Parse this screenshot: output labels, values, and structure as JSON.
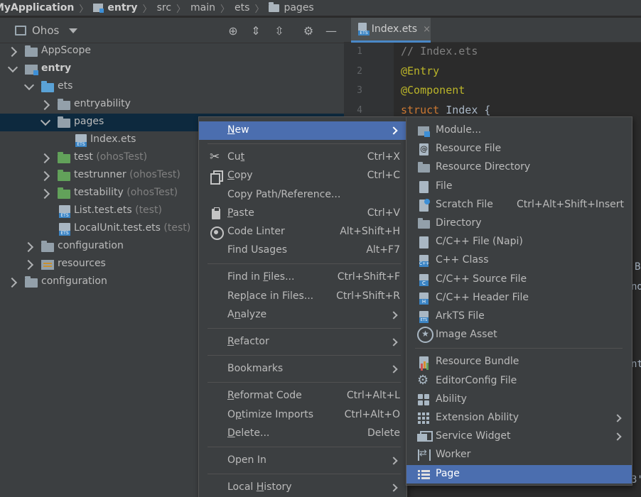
{
  "breadcrumb": [
    "MyApplication",
    "entry",
    "src",
    "main",
    "ets",
    "pages"
  ],
  "project": {
    "view": "Ohos",
    "toolbar_icons": [
      "crosshair-icon",
      "expand-all-icon",
      "collapse-all-icon",
      "gear-icon",
      "minimize-icon"
    ],
    "tree": [
      {
        "label": "AppScope",
        "dim": "",
        "icon": "folder-gray",
        "state": "collapsed",
        "depth": 0
      },
      {
        "label": "entry",
        "dim": "",
        "icon": "module",
        "state": "expanded",
        "depth": 0,
        "bold": true
      },
      {
        "label": "ets",
        "dim": "",
        "icon": "folder-blue",
        "state": "expanded",
        "depth": 1
      },
      {
        "label": "entryability",
        "dim": "",
        "icon": "folder-gray",
        "state": "collapsed",
        "depth": 2
      },
      {
        "label": "pages",
        "dim": "",
        "icon": "folder-gray",
        "state": "expanded",
        "depth": 2,
        "selected": true
      },
      {
        "label": "Index.ets",
        "dim": "",
        "icon": "ets",
        "state": "leaf",
        "depth": 3
      },
      {
        "label": "test",
        "dim": "(ohosTest)",
        "icon": "folder-green",
        "state": "collapsed",
        "depth": 2
      },
      {
        "label": "testrunner",
        "dim": "(ohosTest)",
        "icon": "folder-green",
        "state": "collapsed",
        "depth": 2
      },
      {
        "label": "testability",
        "dim": "(ohosTest)",
        "icon": "folder-green",
        "state": "collapsed",
        "depth": 2
      },
      {
        "label": "List.test.ets",
        "dim": "(test)",
        "icon": "ets",
        "state": "leaf",
        "depth": 2
      },
      {
        "label": "LocalUnit.test.ets",
        "dim": "(test)",
        "icon": "ets",
        "state": "leaf",
        "depth": 2
      },
      {
        "label": "configuration",
        "dim": "",
        "icon": "folder-gray",
        "state": "collapsed",
        "depth": 1
      },
      {
        "label": "resources",
        "dim": "",
        "icon": "resources",
        "state": "collapsed",
        "depth": 1
      },
      {
        "label": "configuration",
        "dim": "",
        "icon": "folder-gray",
        "state": "collapsed",
        "depth": 0
      }
    ]
  },
  "editor": {
    "tab_label": "Index.ets",
    "tab_close": "×",
    "line_numbers": [
      "1",
      "2",
      "3",
      "4"
    ],
    "lines": [
      [
        {
          "t": "// Index.ets",
          "c": "cm"
        }
      ],
      [
        {
          "t": "@Entry",
          "c": "an"
        }
      ],
      [
        {
          "t": "@Component",
          "c": "an"
        }
      ],
      [
        {
          "t": "struct ",
          "c": "kw"
        },
        {
          "t": "Index {",
          "c": "id"
        }
      ]
    ],
    "fragments": [
      "B",
      "nd",
      "nt",
      "3'"
    ]
  },
  "context_menu": [
    {
      "label": "New",
      "u": 0,
      "shortcut": "",
      "icon": "",
      "submenu": true,
      "highlighted": true
    },
    {
      "sep": true
    },
    {
      "label": "Cut",
      "u": 2,
      "shortcut": "Ctrl+X",
      "icon": "scissors"
    },
    {
      "label": "Copy",
      "u": 0,
      "shortcut": "Ctrl+C",
      "icon": "copy"
    },
    {
      "label": "Copy Path/Reference...",
      "u": -1,
      "shortcut": "",
      "icon": ""
    },
    {
      "label": "Paste",
      "u": 0,
      "shortcut": "Ctrl+V",
      "icon": "paste"
    },
    {
      "label": "Code Linter",
      "u": -1,
      "shortcut": "Alt+Shift+H",
      "icon": "linter"
    },
    {
      "label": "Find Usages",
      "u": -1,
      "shortcut": "Alt+F7",
      "icon": ""
    },
    {
      "sep": true
    },
    {
      "label": "Find in Files...",
      "u": 8,
      "shortcut": "Ctrl+Shift+F",
      "icon": ""
    },
    {
      "label": "Replace in Files...",
      "u": 3,
      "shortcut": "Ctrl+Shift+R",
      "icon": ""
    },
    {
      "label": "Analyze",
      "u": 1,
      "shortcut": "",
      "icon": "",
      "submenu": true
    },
    {
      "sep": true
    },
    {
      "label": "Refactor",
      "u": 0,
      "shortcut": "",
      "icon": "",
      "submenu": true
    },
    {
      "sep": true
    },
    {
      "label": "Bookmarks",
      "u": -1,
      "shortcut": "",
      "icon": "",
      "submenu": true
    },
    {
      "sep": true
    },
    {
      "label": "Reformat Code",
      "u": 0,
      "shortcut": "Ctrl+Alt+L",
      "icon": ""
    },
    {
      "label": "Optimize Imports",
      "u": 1,
      "shortcut": "Ctrl+Alt+O",
      "icon": ""
    },
    {
      "label": "Delete...",
      "u": 0,
      "shortcut": "Delete",
      "icon": ""
    },
    {
      "sep": true
    },
    {
      "label": "Open In",
      "u": -1,
      "shortcut": "",
      "icon": "",
      "submenu": true
    },
    {
      "sep": true
    },
    {
      "label": "Local History",
      "u": 6,
      "shortcut": "",
      "icon": "",
      "submenu": true
    }
  ],
  "new_submenu": [
    {
      "label": "Module...",
      "shortcut": "",
      "icon": "module"
    },
    {
      "label": "Resource File",
      "shortcut": "",
      "icon": "resfile"
    },
    {
      "label": "Resource Directory",
      "shortcut": "",
      "icon": "fold"
    },
    {
      "label": "File",
      "shortcut": "",
      "icon": "file"
    },
    {
      "label": "Scratch File",
      "shortcut": "Ctrl+Alt+Shift+Insert",
      "icon": "scratch"
    },
    {
      "label": "Directory",
      "shortcut": "",
      "icon": "fold"
    },
    {
      "label": "C/C++ File (Napi)",
      "shortcut": "",
      "icon": "file"
    },
    {
      "label": "C++ Class",
      "shortcut": "",
      "icon": "cpp"
    },
    {
      "label": "C/C++ Source File",
      "shortcut": "",
      "icon": "c"
    },
    {
      "label": "C/C++ Header File",
      "shortcut": "",
      "icon": "h"
    },
    {
      "label": "ArkTS File",
      "shortcut": "",
      "icon": "etsfile"
    },
    {
      "label": "Image Asset",
      "shortcut": "",
      "icon": "star"
    },
    {
      "sep": true
    },
    {
      "label": "Resource Bundle",
      "shortcut": "",
      "icon": "bundle"
    },
    {
      "label": "EditorConfig File",
      "shortcut": "",
      "icon": "gear"
    },
    {
      "label": "Ability",
      "shortcut": "",
      "icon": "ability"
    },
    {
      "label": "Extension Ability",
      "shortcut": "",
      "icon": "ext",
      "submenu": true
    },
    {
      "label": "Service Widget",
      "shortcut": "",
      "icon": "widget",
      "submenu": true
    },
    {
      "label": "Worker",
      "shortcut": "",
      "icon": "worker"
    },
    {
      "label": "Page",
      "shortcut": "",
      "icon": "page",
      "highlighted": true
    }
  ]
}
